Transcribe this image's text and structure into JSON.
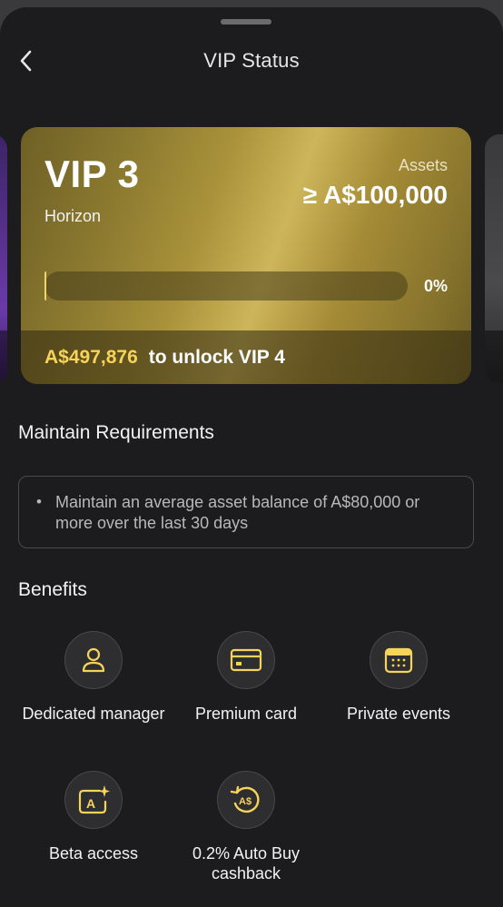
{
  "header": {
    "title": "VIP Status"
  },
  "vip_card": {
    "level": "VIP 3",
    "tier_name": "Horizon",
    "assets_label": "Assets",
    "assets_threshold": "≥ A$100,000",
    "progress_percent_label": "0%",
    "progress_fraction": 0,
    "unlock_amount": "A$497,876",
    "unlock_text": "to unlock VIP 4"
  },
  "maintain": {
    "title": "Maintain Requirements",
    "items": [
      "Maintain an average asset balance of A$80,000 or more over the last 30 days"
    ]
  },
  "benefits": {
    "title": "Benefits",
    "items": [
      {
        "label": "Dedicated manager",
        "icon": "user-icon"
      },
      {
        "label": "Premium card",
        "icon": "card-icon"
      },
      {
        "label": "Private events",
        "icon": "calendar-icon"
      },
      {
        "label": "Beta access",
        "icon": "beta-sparkle-icon"
      },
      {
        "label": "0.2% Auto Buy cashback",
        "icon": "cashback-icon"
      }
    ]
  },
  "colors": {
    "accent_gold": "#f6d35a",
    "background": "#1c1c1e"
  }
}
